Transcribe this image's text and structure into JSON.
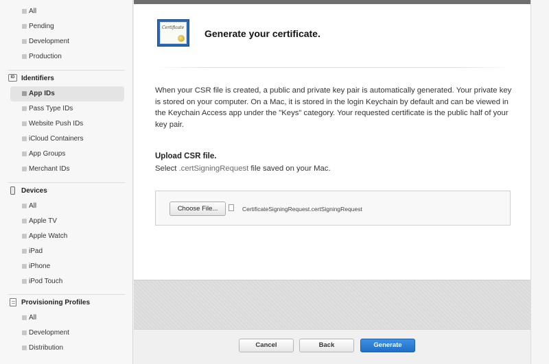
{
  "sidebar": {
    "certificates_items": [
      "All",
      "Pending",
      "Development",
      "Production"
    ],
    "identifiers": {
      "header": "Identifiers",
      "icon_label": "ID",
      "items": [
        "App IDs",
        "Pass Type IDs",
        "Website Push IDs",
        "iCloud Containers",
        "App Groups",
        "Merchant IDs"
      ],
      "selected": "App IDs"
    },
    "devices": {
      "header": "Devices",
      "items": [
        "All",
        "Apple TV",
        "Apple Watch",
        "iPad",
        "iPhone",
        "iPod Touch"
      ]
    },
    "provisioning": {
      "header": "Provisioning Profiles",
      "items": [
        "All",
        "Development",
        "Distribution"
      ]
    }
  },
  "main": {
    "cert_icon_text": "Certificate",
    "title": "Generate your certificate.",
    "description": "When your CSR file is created, a public and private key pair is automatically generated. Your private key is stored on your computer. On a Mac, it is stored in the login Keychain by default and can be viewed in the Keychain Access app under the \"Keys\" category. Your requested certificate is the public half of your key pair.",
    "upload": {
      "heading": "Upload CSR file.",
      "instruction_prefix": "Select ",
      "instruction_ext": ".certSigningRequest",
      "instruction_suffix": " file saved on your Mac.",
      "choose_label": "Choose File...",
      "file_name": "CertificateSigningRequest.certSigningRequest"
    }
  },
  "footer": {
    "cancel": "Cancel",
    "back": "Back",
    "generate": "Generate"
  },
  "colors": {
    "primary_button": "#2a7ad6",
    "top_bar": "#6f6f6f",
    "sidebar_bg": "#f7f7f7"
  }
}
